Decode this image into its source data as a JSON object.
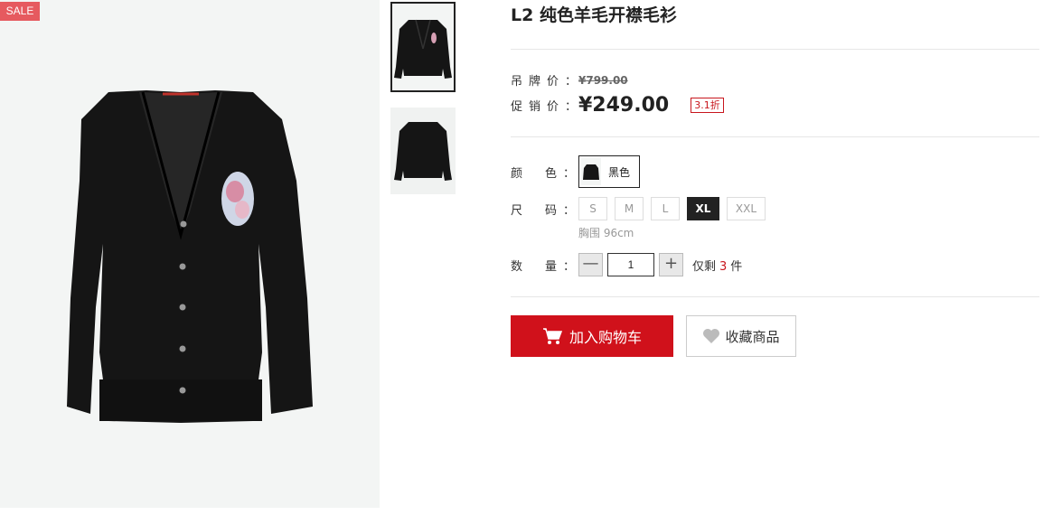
{
  "product": {
    "badge": "SALE",
    "title": "L2 纯色羊毛开襟毛衫"
  },
  "price": {
    "tag_label": [
      "吊",
      "牌",
      "价",
      "："
    ],
    "tag_price": "¥799.00",
    "promo_label": [
      "促",
      "销",
      "价",
      "："
    ],
    "promo_price": "¥249.00",
    "discount": "3.1折"
  },
  "options": {
    "color_label": [
      "颜",
      "色",
      "："
    ],
    "color_value": "黑色",
    "size_label": [
      "尺",
      "码",
      "："
    ],
    "sizes": [
      "S",
      "M",
      "L",
      "XL",
      "XXL"
    ],
    "selected_size": "XL",
    "size_note": "胸围 96cm",
    "qty_label": [
      "数",
      "量",
      "："
    ],
    "qty_minus": "—",
    "qty_plus": "+",
    "qty_value": "1",
    "stock_prefix": "仅剩",
    "stock_count": "3",
    "stock_unit": "件"
  },
  "actions": {
    "add_to_cart": "加入购物车",
    "favorite": "收藏商品"
  },
  "colors": {
    "accent": "#d0111b",
    "sale_badge": "#e65a5f"
  }
}
